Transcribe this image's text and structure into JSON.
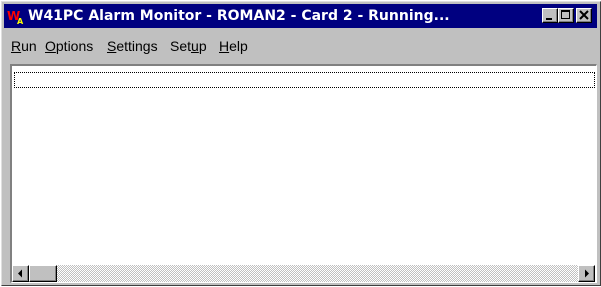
{
  "window": {
    "title": "W41PC Alarm Monitor - ROMAN2 - Card 2 - Running...",
    "app_icon": "w41-app-icon",
    "controls": [
      "minimize-icon",
      "maximize-icon",
      "close-icon"
    ]
  },
  "menu": {
    "items": [
      {
        "mnemonic": "R",
        "rest": "un"
      },
      {
        "mnemonic": "O",
        "rest": "ptions"
      },
      {
        "mnemonic": "S",
        "rest": "ettings"
      },
      {
        "pre": "Set",
        "mnemonic": "u",
        "rest": "p"
      },
      {
        "mnemonic": "H",
        "rest": "elp"
      }
    ]
  },
  "list": {
    "rows": []
  },
  "colors": {
    "titlebar": "#000080",
    "face": "#c0c0c0",
    "client": "#ffffff"
  }
}
